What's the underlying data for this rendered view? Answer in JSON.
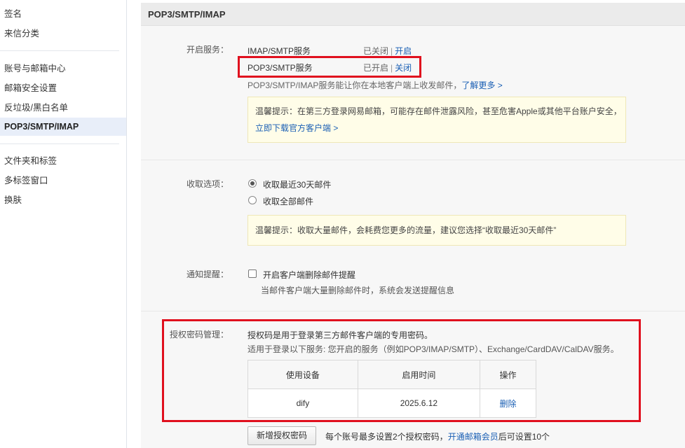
{
  "sidebar": {
    "items": [
      {
        "label": "签名"
      },
      {
        "label": "来信分类"
      },
      {
        "label": "账号与邮箱中心"
      },
      {
        "label": "邮箱安全设置"
      },
      {
        "label": "反垃圾/黑白名单"
      },
      {
        "label": "POP3/SMTP/IMAP"
      },
      {
        "label": "文件夹和标签"
      },
      {
        "label": "多标签窗口"
      },
      {
        "label": "换肤"
      }
    ],
    "active_index": 5
  },
  "main": {
    "header_title": "POP3/SMTP/IMAP",
    "services": {
      "label": "开启服务：",
      "imap": {
        "name": "IMAP/SMTP服务",
        "status": "已关闭",
        "sep": "|",
        "action": "开启"
      },
      "pop3": {
        "name": "POP3/SMTP服务",
        "status": "已开启",
        "sep": "|",
        "action": "关闭"
      },
      "desc": "POP3/SMTP/IMAP服务能让你在本地客户端上收发邮件，",
      "learn_more": "了解更多 >",
      "tip_line1": "温馨提示：在第三方登录网易邮箱，可能存在邮件泄露风险，甚至危害Apple或其他平台账户安全，",
      "tip_link": "立即下载官方客户端 >"
    },
    "fetch": {
      "label": "收取选项：",
      "option_recent": "收取最近30天邮件",
      "option_all": "收取全部邮件",
      "selected": "收取最近30天邮件",
      "tip": "温馨提示：收取大量邮件，会耗费您更多的流量，建议您选择“收取最近30天邮件”"
    },
    "notify": {
      "label": "通知提醒：",
      "checkbox_label": "开启客户端删除邮件提醒",
      "checked": false,
      "desc": "当邮件客户端大量删除邮件时，系统会发送提醒信息"
    },
    "auth": {
      "label": "授权密码管理：",
      "desc1": "授权码是用于登录第三方邮件客户端的专用密码。",
      "desc2": "适用于登录以下服务: 您开启的服务（例如POP3/IMAP/SMTP）、Exchange/CardDAV/CalDAV服务。",
      "table": {
        "headers": [
          "使用设备",
          "启用时间",
          "操作"
        ],
        "rows": [
          {
            "device": "dify",
            "time": "2025.6.12",
            "action": "删除"
          }
        ]
      },
      "add_button": "新增授权密码",
      "limit_text": "每个账号最多设置2个授权密码，",
      "member_link": "开通邮箱会员",
      "limit_suffix": "后可设置10个"
    }
  },
  "colors": {
    "link": "#1a5fb4",
    "highlight_box": "#e0101e",
    "tip_bg": "#fffde8",
    "sidebar_active_bg": "#e8eef9"
  }
}
